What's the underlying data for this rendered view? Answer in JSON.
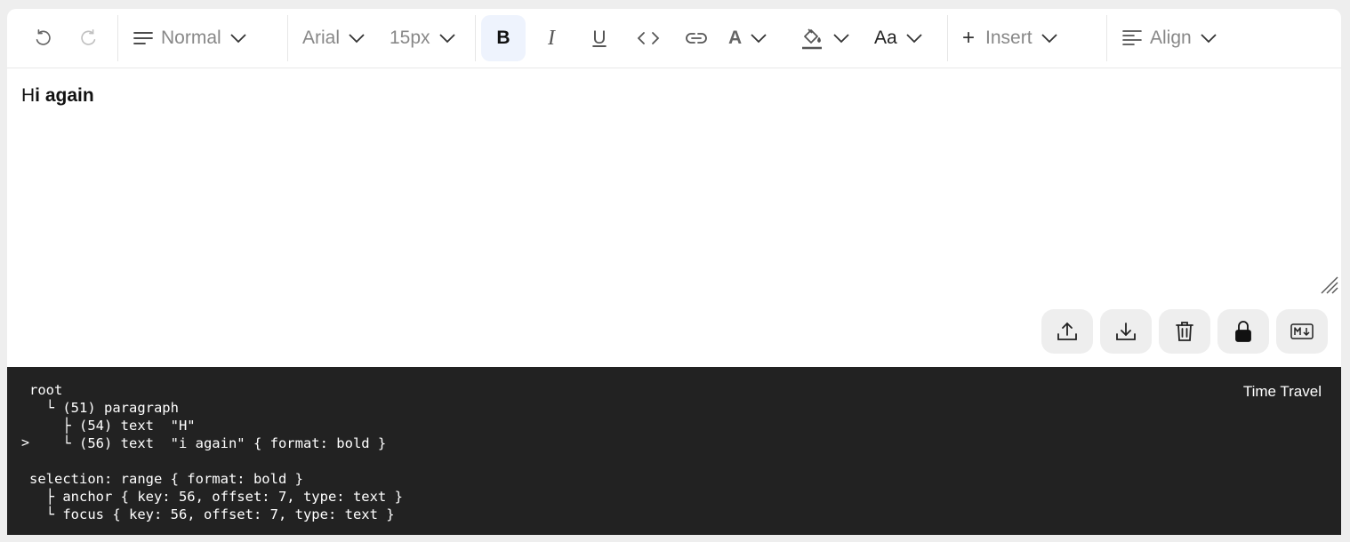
{
  "toolbar": {
    "block_type": "Normal",
    "font_family": "Arial",
    "font_size": "15px",
    "insert_label": "Insert",
    "align_label": "Align",
    "case_label": "Aa",
    "bold_label": "B",
    "italic_label": "I",
    "underline_label": "U",
    "text_color_label": "A",
    "insert_plus": "+",
    "bold_active": true,
    "undo_enabled": true,
    "redo_enabled": false
  },
  "editor": {
    "text_plain": "H",
    "text_bold": "i again"
  },
  "tree_view": {
    "lines": [
      "root",
      "  └ (51) paragraph",
      "    ├ (54) text  \"H\"",
      "    └ (56) text  \"i again\" { format: bold }",
      "",
      "selection: range { format: bold }",
      "  ├ anchor { key: 56, offset: 7, type: text }",
      "  └ focus { key: 56, offset: 7, type: text }"
    ],
    "arrow": ">",
    "time_travel_label": "Time Travel"
  },
  "icons": {
    "undo": "undo-icon",
    "redo": "redo-icon",
    "paragraph": "paragraph-icon",
    "code": "code-icon",
    "link": "link-icon",
    "bg_color": "paint-bucket-icon",
    "insert": "plus-icon",
    "align": "align-left-icon",
    "import": "upload-icon",
    "export": "download-icon",
    "clear": "trash-icon",
    "lock": "lock-icon",
    "markdown": "markdown-icon"
  },
  "colors": {
    "active_bg": "#eef3fd",
    "tree_bg": "#222222",
    "action_bg": "#eeeeee"
  }
}
